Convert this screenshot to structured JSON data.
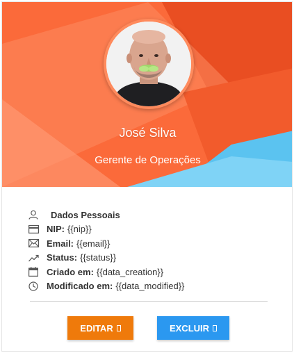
{
  "profile": {
    "name": "José Silva",
    "role": "Gerente de Operações"
  },
  "details": {
    "section_title": "Dados Pessoais",
    "nip_label": "NIP:",
    "nip_value": "{{nip}}",
    "email_label": "Email:",
    "email_value": "{{email}}",
    "status_label": "Status:",
    "status_value": "{{status}}",
    "created_label": "Criado em:",
    "created_value": "{{data_creation}}",
    "modified_label": "Modificado em:",
    "modified_value": "{{data_modified}}"
  },
  "icons": {
    "section": "user-icon",
    "nip": "id-card-icon",
    "email": "envelope-icon",
    "status": "trend-line-icon",
    "created": "calendar-icon",
    "modified": "clock-icon"
  },
  "actions": {
    "edit_label": "EDITAR",
    "delete_label": "EXCLUIR"
  },
  "colors": {
    "edit_button": "#ef7a0b",
    "delete_button": "#2b98f0",
    "hero_primary": "#fb6a3a",
    "hero_accent": "#5bc3f0"
  }
}
